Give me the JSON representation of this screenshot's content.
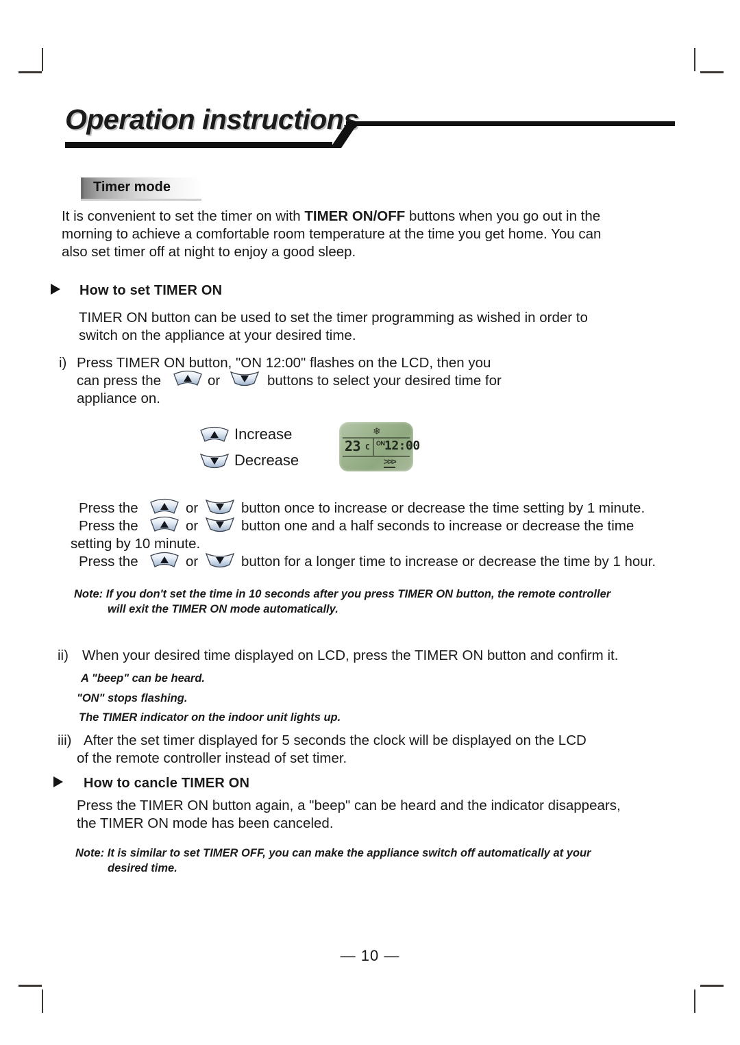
{
  "header": {
    "title": "Operation instructions"
  },
  "section": {
    "label": "Timer mode"
  },
  "intro": {
    "line1_a": "It is convenient to set the timer on with ",
    "line1_b": "TIMER ON/OFF",
    "line1_c": " buttons when you go out in the",
    "line2": "morning to achieve a comfortable room temperature at the time you get home. You can",
    "line3": "also set timer off at night to enjoy a good sleep."
  },
  "how_to_set": {
    "heading": "How  to set TIMER ON",
    "desc_line1": "TIMER ON button can be  used to set the timer programming as wished in order  to",
    "desc_line2": "switch on  the appliance at your desired time.",
    "step_i": {
      "marker": "i)",
      "line1": "Press TIMER ON button, \"ON 12:00\" flashes on the LCD, then you",
      "line2_a": "can press the",
      "line2_or": "or",
      "line2_b": "buttons to select your desired time for",
      "line3": "appliance on."
    }
  },
  "legend": {
    "increase": "Increase",
    "decrease": "Decrease"
  },
  "lcd": {
    "mode_icon": "snowflake-icon",
    "temperature": "23",
    "unit": "C",
    "timer_label": "ON",
    "time": "12:00",
    "fan_indicator": ">>>"
  },
  "press_lines": [
    {
      "prefix": "Press the",
      "or": "or",
      "suffix": "button once to increase or decrease the time setting by 1 minute."
    },
    {
      "prefix": "Press the",
      "or": "or",
      "suffix": "button one and a half seconds to increase or decrease the time"
    },
    {
      "prefix": "Press the",
      "or": "or",
      "suffix": "button for a longer time to increase or decrease the time by 1 hour."
    }
  ],
  "press_continuation": "setting by 10 minute.",
  "note_1": {
    "line1": "Note: If you don't set the time in 10 seconds after you press TIMER ON button, the remote controller",
    "line2": "will exit the TIMER ON  mode automatically."
  },
  "step_ii": {
    "marker": "ii)",
    "line1": "When your desired time displayed on LCD, press the TIMER ON button and confirm it.",
    "sub1": "A \"beep\" can be heard.",
    "sub2": "\"ON\"  stops flashing.",
    "sub3": "The TIMER indicator on the indoor unit lights up."
  },
  "step_iii": {
    "marker": "iii)",
    "line1": "After the set timer displayed for 5 seconds the clock will be displayed on the LCD",
    "line2": "of the remote controller instead of set timer."
  },
  "how_to_cancel": {
    "heading": "How  to cancle  TIMER ON",
    "line1": "Press the TIMER ON button again, a \"beep\" can be heard and the  indicator disappears,",
    "line2": "the TIMER ON mode has been canceled."
  },
  "note_2": {
    "line1": "Note: It is similar to set TIMER OFF, you can make the appliance switch off automatically at your",
    "line2": "desired time."
  },
  "footer": {
    "page_number": "— 10 —"
  },
  "colors": {
    "ink": "#1a1a1a",
    "banner_bar": "#111111",
    "lcd_green": "#9db48e",
    "button_blue": "#c3d2e4"
  }
}
